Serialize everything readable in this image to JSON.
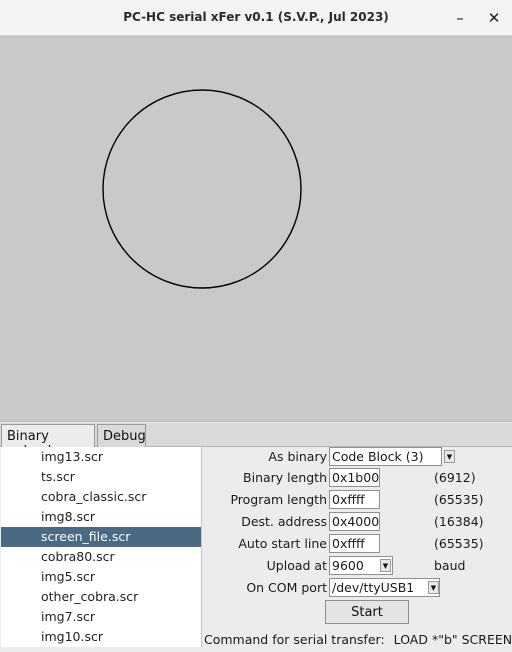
{
  "window": {
    "title": "PC-HC serial xFer v0.1 (S.V.P., Jul 2023)",
    "minimize_label": "–",
    "close_label": "✕"
  },
  "tabs": [
    {
      "label": "Binary upload",
      "active": true
    },
    {
      "label": "Debug",
      "active": false
    }
  ],
  "files": [
    {
      "name": "img13.scr",
      "selected": false
    },
    {
      "name": "ts.scr",
      "selected": false
    },
    {
      "name": "cobra_classic.scr",
      "selected": false
    },
    {
      "name": "img8.scr",
      "selected": false
    },
    {
      "name": "screen_file.scr",
      "selected": true
    },
    {
      "name": "cobra80.scr",
      "selected": false
    },
    {
      "name": "img5.scr",
      "selected": false
    },
    {
      "name": "other_cobra.scr",
      "selected": false
    },
    {
      "name": "img7.scr",
      "selected": false
    },
    {
      "name": "img10.scr",
      "selected": false
    }
  ],
  "form": {
    "as_binary": {
      "label": "As binary",
      "value": "Code Block (3)"
    },
    "binary_length": {
      "label": "Binary length",
      "value": "0x1b00",
      "decimal": "(6912)"
    },
    "program_length": {
      "label": "Program length",
      "value": "0xffff",
      "decimal": "(65535)"
    },
    "dest_address": {
      "label": "Dest. address",
      "value": "0x4000",
      "decimal": "(16384)"
    },
    "auto_start_line": {
      "label": "Auto start line",
      "value": "0xffff",
      "decimal": "(65535)"
    },
    "upload_at": {
      "label": "Upload at",
      "value": "9600",
      "unit": "baud"
    },
    "com_port": {
      "label": "On COM port",
      "value": "/dev/ttyUSB1"
    },
    "start_label": "Start",
    "command_label": "Command for serial transfer:",
    "command_value": "LOAD *\"b\" SCREEN$"
  },
  "colors": {
    "selection": "#4a6984",
    "preview_bg": "#c9c9c9",
    "stroke": "#000000"
  },
  "icons": {
    "dropdown": "triangle-down"
  }
}
